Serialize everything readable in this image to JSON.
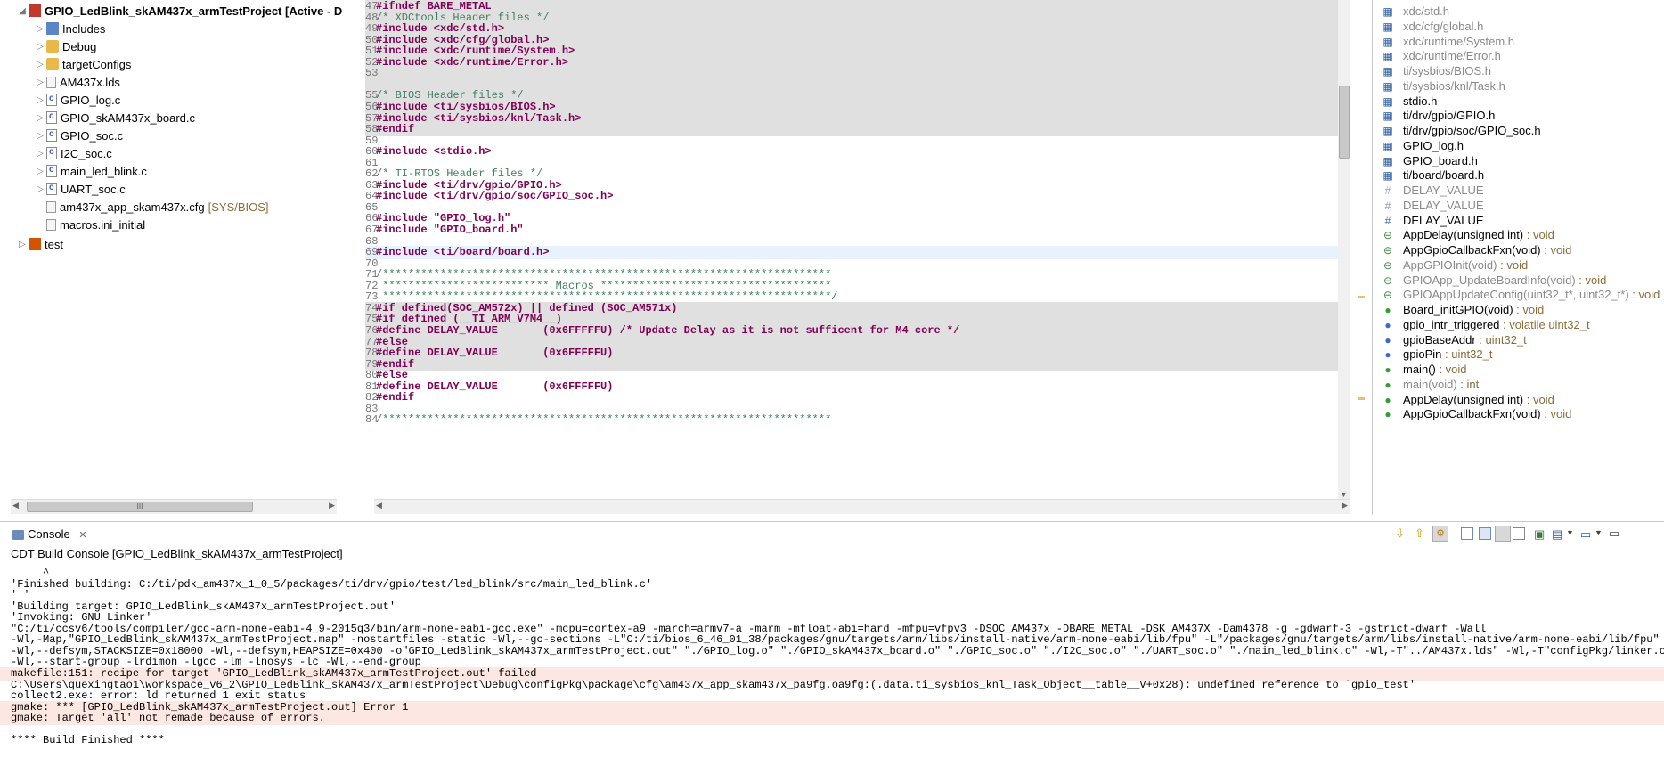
{
  "explorer": {
    "project_title": "GPIO_LedBlink_skAM437x_armTestProject  [Active - D",
    "items": [
      {
        "label": "Includes"
      },
      {
        "label": "Debug"
      },
      {
        "label": "targetConfigs"
      },
      {
        "label": "AM437x.lds"
      },
      {
        "label": "GPIO_log.c"
      },
      {
        "label": "GPIO_skAM437x_board.c"
      },
      {
        "label": "GPIO_soc.c"
      },
      {
        "label": "I2C_soc.c"
      },
      {
        "label": "main_led_blink.c"
      },
      {
        "label": "UART_soc.c"
      },
      {
        "label": "am437x_app_skam437x.cfg",
        "tag": "[SYS/BIOS]"
      },
      {
        "label": "macros.ini_initial"
      }
    ],
    "second_project": "test",
    "scroll_grip": "III"
  },
  "editor": {
    "lines": [
      {
        "n": "47",
        "text": "#ifndef BARE_METAL"
      },
      {
        "n": "48",
        "text": "/* XDCtools Header files */"
      },
      {
        "n": "49",
        "text": "#include <xdc/std.h>"
      },
      {
        "n": "50",
        "text": "#include <xdc/cfg/global.h>"
      },
      {
        "n": "51",
        "text": "#include <xdc/runtime/System.h>"
      },
      {
        "n": "52",
        "text": "#include <xdc/runtime/Error.h>"
      },
      {
        "n": "53",
        "text": ""
      },
      {
        "n": "",
        "text": ""
      },
      {
        "n": "55",
        "text": "/* BIOS Header files */"
      },
      {
        "n": "56",
        "text": "#include <ti/sysbios/BIOS.h>"
      },
      {
        "n": "57",
        "text": "#include <ti/sysbios/knl/Task.h>"
      },
      {
        "n": "58",
        "text": "#endif"
      },
      {
        "n": "59",
        "text": ""
      },
      {
        "n": "60",
        "text": "#include <stdio.h>"
      },
      {
        "n": "61",
        "text": ""
      },
      {
        "n": "62",
        "text": "/* TI-RTOS Header files */"
      },
      {
        "n": "63",
        "text": "#include <ti/drv/gpio/GPIO.h>"
      },
      {
        "n": "64",
        "text": "#include <ti/drv/gpio/soc/GPIO_soc.h>"
      },
      {
        "n": "65",
        "text": ""
      },
      {
        "n": "66",
        "text": "#include \"GPIO_log.h\""
      },
      {
        "n": "67",
        "text": "#include \"GPIO_board.h\""
      },
      {
        "n": "68",
        "text": ""
      },
      {
        "n": "69",
        "text": "#include <ti/board/board.h>"
      },
      {
        "n": "70",
        "text": ""
      },
      {
        "n": "71",
        "text": "/**********************************************************************"
      },
      {
        "n": "72",
        "text": " ************************** Macros ************************************"
      },
      {
        "n": "73",
        "text": " **********************************************************************/"
      },
      {
        "n": "74",
        "text": "#if defined(SOC_AM572x) || defined (SOC_AM571x)"
      },
      {
        "n": "75",
        "text": "#if defined (__TI_ARM_V7M4__)"
      },
      {
        "n": "76",
        "text": "#define DELAY_VALUE       (0x6FFFFFU) /* Update Delay as it is not sufficent for M4 core */"
      },
      {
        "n": "77",
        "text": "#else"
      },
      {
        "n": "78",
        "text": "#define DELAY_VALUE       (0x6FFFFFU)"
      },
      {
        "n": "79",
        "text": "#endif"
      },
      {
        "n": "80",
        "text": "#else"
      },
      {
        "n": "81",
        "text": "#define DELAY_VALUE       (0x6FFFFFU)"
      },
      {
        "n": "82",
        "text": "#endif"
      },
      {
        "n": "83",
        "text": ""
      },
      {
        "n": "84",
        "text": "/**********************************************************************"
      }
    ]
  },
  "outline": {
    "items": [
      {
        "label": "xdc/std.h",
        "type": ""
      },
      {
        "label": "xdc/cfg/global.h",
        "type": ""
      },
      {
        "label": "xdc/runtime/System.h",
        "type": ""
      },
      {
        "label": "xdc/runtime/Error.h",
        "type": ""
      },
      {
        "label": "ti/sysbios/BIOS.h",
        "type": ""
      },
      {
        "label": "ti/sysbios/knl/Task.h",
        "type": ""
      },
      {
        "label": "stdio.h",
        "type": ""
      },
      {
        "label": "ti/drv/gpio/GPIO.h",
        "type": ""
      },
      {
        "label": "ti/drv/gpio/soc/GPIO_soc.h",
        "type": ""
      },
      {
        "label": "GPIO_log.h",
        "type": ""
      },
      {
        "label": "GPIO_board.h",
        "type": ""
      },
      {
        "label": "ti/board/board.h",
        "type": ""
      },
      {
        "label": "DELAY_VALUE",
        "type": ""
      },
      {
        "label": "DELAY_VALUE",
        "type": ""
      },
      {
        "label": "DELAY_VALUE",
        "type": ""
      },
      {
        "label": "AppDelay(unsigned int)",
        "type": " : void"
      },
      {
        "label": "AppGpioCallbackFxn(void)",
        "type": " : void"
      },
      {
        "label": "AppGPIOInit(void)",
        "type": " : void"
      },
      {
        "label": "GPIOApp_UpdateBoardInfo(void)",
        "type": " : void"
      },
      {
        "label": "GPIOAppUpdateConfig(uint32_t*, uint32_t*)",
        "type": " : void"
      },
      {
        "label": "Board_initGPIO(void)",
        "type": " : void"
      },
      {
        "label": "gpio_intr_triggered",
        "type": " : volatile uint32_t"
      },
      {
        "label": "gpioBaseAddr",
        "type": " : uint32_t"
      },
      {
        "label": "gpioPin",
        "type": " : uint32_t"
      },
      {
        "label": "main()",
        "type": " : void"
      },
      {
        "label": "main(void)",
        "type": " : int"
      },
      {
        "label": "AppDelay(unsigned int)",
        "type": " : void"
      },
      {
        "label": "AppGpioCallbackFxn(void)",
        "type": " : void"
      }
    ]
  },
  "console": {
    "tab_label": "Console",
    "header": "CDT Build Console [GPIO_LedBlink_skAM437x_armTestProject]",
    "lines": [
      {
        "text": "     ^",
        "error": false
      },
      {
        "text": "'Finished building: C:/ti/pdk_am437x_1_0_5/packages/ti/drv/gpio/test/led_blink/src/main_led_blink.c'",
        "error": false
      },
      {
        "text": "' '",
        "error": false
      },
      {
        "text": "'Building target: GPIO_LedBlink_skAM437x_armTestProject.out'",
        "error": false
      },
      {
        "text": "'Invoking: GNU Linker'",
        "error": false
      },
      {
        "text": "\"C:/ti/ccsv6/tools/compiler/gcc-arm-none-eabi-4_9-2015q3/bin/arm-none-eabi-gcc.exe\" -mcpu=cortex-a9 -march=armv7-a -marm -mfloat-abi=hard -mfpu=vfpv3 -DSOC_AM437x -DBARE_METAL -DSK_AM437X -Dam4378 -g -gdwarf-3 -gstrict-dwarf -Wall",
        "error": false
      },
      {
        "text": "-Wl,-Map,\"GPIO_LedBlink_skAM437x_armTestProject.map\" -nostartfiles -static -Wl,--gc-sections -L\"C:/ti/bios_6_46_01_38/packages/gnu/targets/arm/libs/install-native/arm-none-eabi/lib/fpu\" -L\"/packages/gnu/targets/arm/libs/install-native/arm-none-eabi/lib/fpu\"",
        "error": false
      },
      {
        "text": "-Wl,--defsym,STACKSIZE=0x18000 -Wl,--defsym,HEAPSIZE=0x400 -o\"GPIO_LedBlink_skAM437x_armTestProject.out\" \"./GPIO_log.o\" \"./GPIO_skAM437x_board.o\" \"./GPIO_soc.o\" \"./I2C_soc.o\" \"./UART_soc.o\" \"./main_led_blink.o\" -Wl,-T\"../AM437x.lds\" -Wl,-T\"configPkg/linker.cmd\"",
        "error": false
      },
      {
        "text": "-Wl,--start-group -lrdimon -lgcc -lm -lnosys -lc -Wl,--end-group",
        "error": false
      },
      {
        "text": "makefile:151: recipe for target 'GPIO_LedBlink_skAM437x_armTestProject.out' failed",
        "error": true
      },
      {
        "text": "C:\\Users\\quexingtao1\\workspace_v6_2\\GPIO_LedBlink_skAM437x_armTestProject\\Debug\\configPkg\\package\\cfg\\am437x_app_skam437x_pa9fg.oa9fg:(.data.ti_sysbios_knl_Task_Object__table__V+0x28): undefined reference to `gpio_test'",
        "error": false
      },
      {
        "text": "collect2.exe: error: ld returned 1 exit status",
        "error": false
      },
      {
        "text": "gmake: *** [GPIO_LedBlink_skAM437x_armTestProject.out] Error 1",
        "error": true
      },
      {
        "text": "gmake: Target 'all' not remade because of errors.",
        "error": true
      },
      {
        "text": "",
        "error": false
      },
      {
        "text": "**** Build Finished ****",
        "error": false
      }
    ]
  }
}
